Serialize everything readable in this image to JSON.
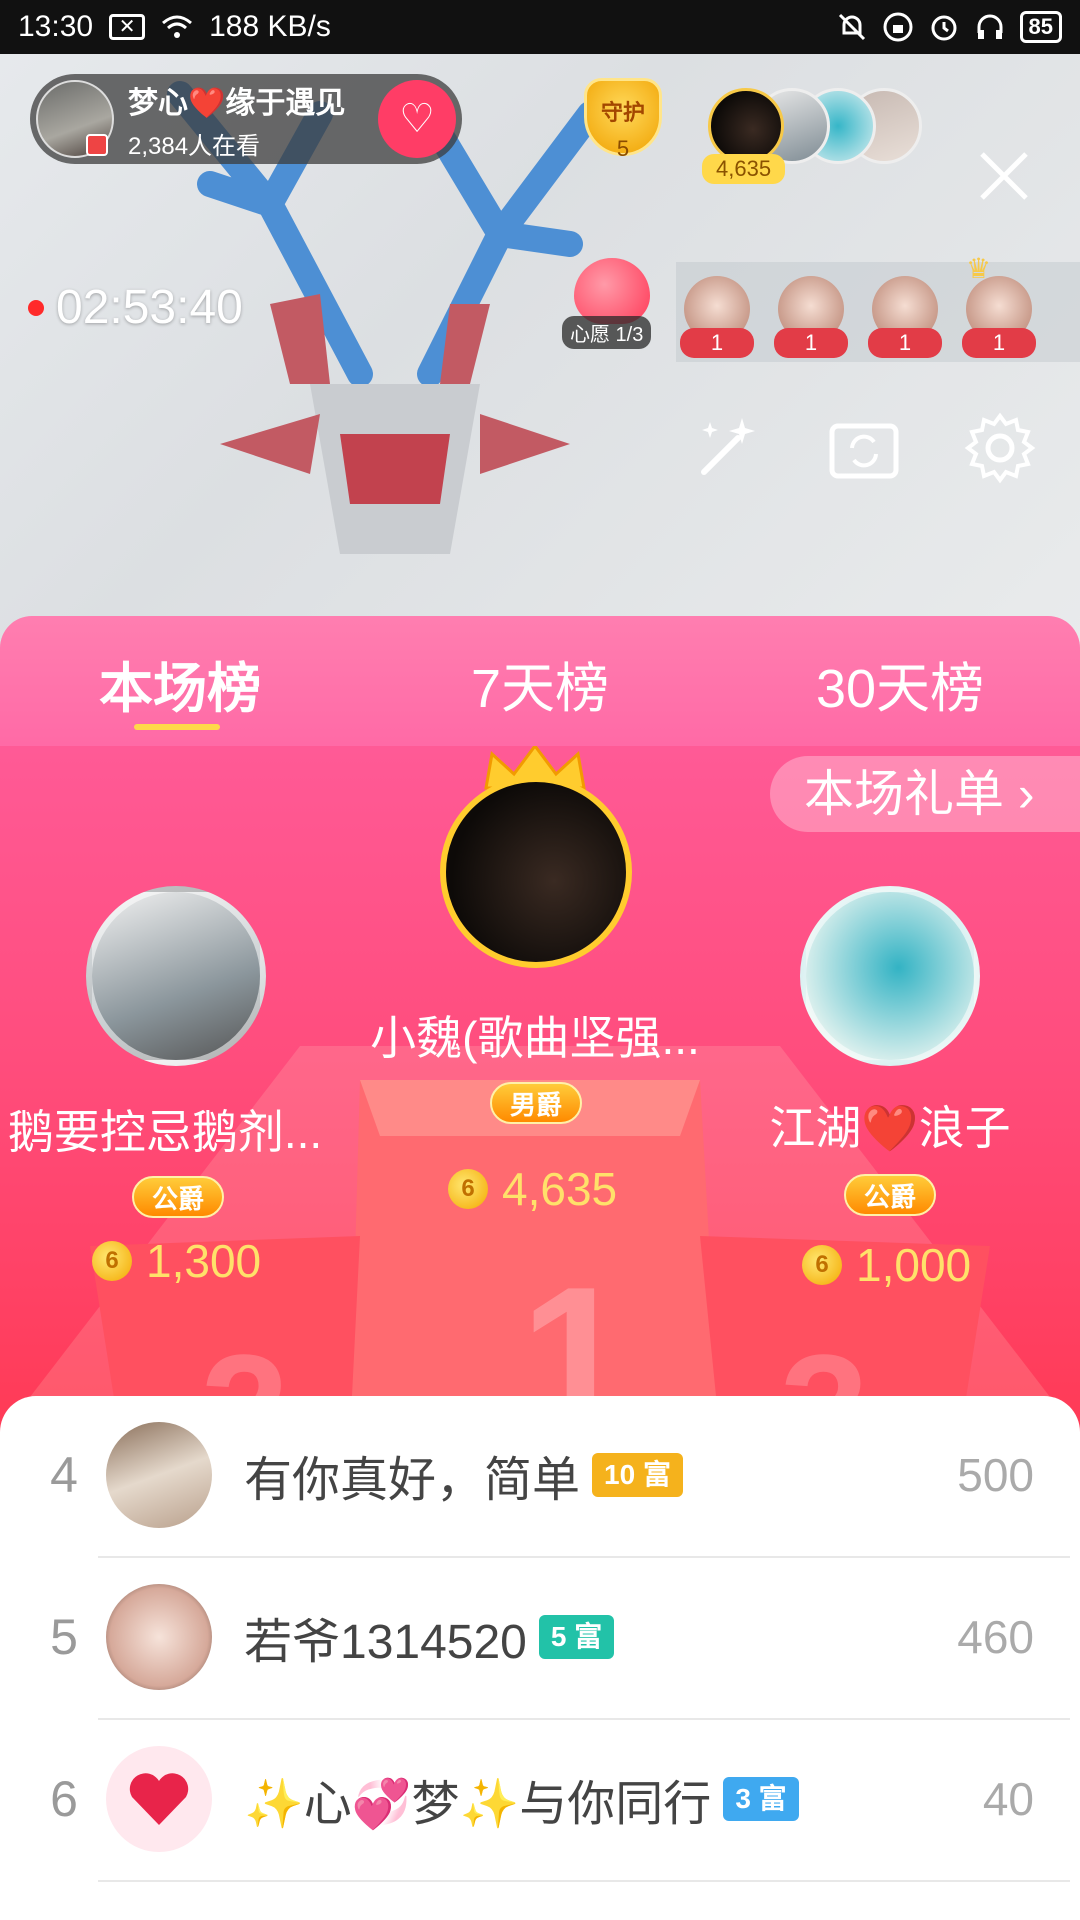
{
  "status_bar": {
    "time": "13:30",
    "speed": "188 KB/s",
    "battery": "85"
  },
  "live": {
    "host_name": "梦心❤️缘于遇见",
    "viewers": "2,384人在看",
    "guard_label": "守护",
    "guard_count": "5",
    "top_score": "4,635",
    "timer": "02:53:40",
    "wish_label": "心愿 1/3",
    "mic_counts": [
      "1",
      "1",
      "1",
      "1"
    ]
  },
  "tabs": [
    {
      "label": "本场榜"
    },
    {
      "label": "7天榜"
    },
    {
      "label": "30天榜"
    }
  ],
  "gift_list_label": "本场礼单 ›",
  "podium": {
    "first": {
      "name": "小魏(歌曲坚强...",
      "badge": "男爵",
      "score": "4,635"
    },
    "second": {
      "name": "鹅要控忌鹅剂...",
      "badge": "公爵",
      "score": "1,300"
    },
    "third": {
      "name": "江湖❤️浪子",
      "badge": "公爵",
      "score": "1,000"
    },
    "podium_numbers": [
      "2",
      "1",
      "3"
    ]
  },
  "list": [
    {
      "rank": "4",
      "name": "有你真好，简单",
      "rich": "10 富",
      "rich_color": "#f5b21c",
      "score": "500"
    },
    {
      "rank": "5",
      "name": "若爷1314520",
      "rich": "5 富",
      "rich_color": "#22c2a8",
      "score": "460"
    },
    {
      "rank": "6",
      "name": "✨心💞梦✨与你同行",
      "rich": "3 富",
      "rich_color": "#3fa9f0",
      "score": "40"
    }
  ],
  "colors": {
    "panel_pink": "#ff5a96",
    "accent_red": "#ff3a55",
    "gold": "#ffd84a"
  }
}
